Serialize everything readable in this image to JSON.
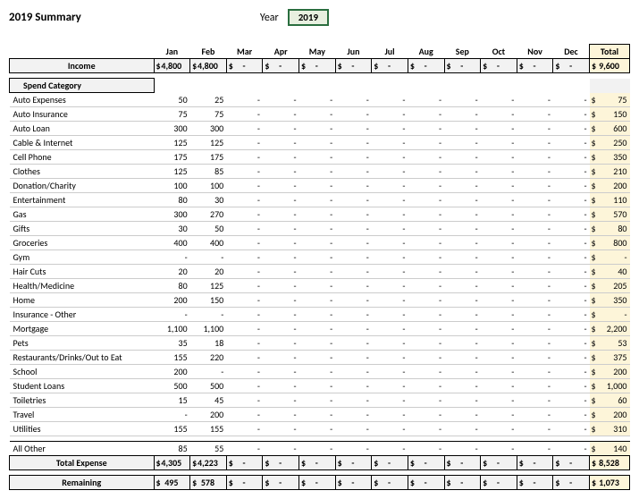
{
  "title": "2019 Summary",
  "year_label": "Year",
  "year_value": "2019",
  "months": [
    "Jan",
    "Feb",
    "Mar",
    "Apr",
    "May",
    "Jun",
    "Jul",
    "Aug",
    "Sep",
    "Oct",
    "Nov",
    "Dec"
  ],
  "total_label": "Total",
  "income_label": "Income",
  "income": {
    "vals": [
      "4,800",
      "4,800",
      "-",
      "-",
      "-",
      "-",
      "-",
      "-",
      "-",
      "-",
      "-",
      "-"
    ],
    "total": "9,600"
  },
  "spend_header": "Spend Category",
  "categories": [
    {
      "name": "Auto Expenses",
      "vals": [
        "50",
        "25",
        "-",
        "-",
        "-",
        "-",
        "-",
        "-",
        "-",
        "-",
        "-",
        "-"
      ],
      "total": "75"
    },
    {
      "name": "Auto Insurance",
      "vals": [
        "75",
        "75",
        "-",
        "-",
        "-",
        "-",
        "-",
        "-",
        "-",
        "-",
        "-",
        "-"
      ],
      "total": "150"
    },
    {
      "name": "Auto Loan",
      "vals": [
        "300",
        "300",
        "-",
        "-",
        "-",
        "-",
        "-",
        "-",
        "-",
        "-",
        "-",
        "-"
      ],
      "total": "600"
    },
    {
      "name": "Cable & Internet",
      "vals": [
        "125",
        "125",
        "-",
        "-",
        "-",
        "-",
        "-",
        "-",
        "-",
        "-",
        "-",
        "-"
      ],
      "total": "250"
    },
    {
      "name": "Cell Phone",
      "vals": [
        "175",
        "175",
        "-",
        "-",
        "-",
        "-",
        "-",
        "-",
        "-",
        "-",
        "-",
        "-"
      ],
      "total": "350"
    },
    {
      "name": "Clothes",
      "vals": [
        "125",
        "85",
        "-",
        "-",
        "-",
        "-",
        "-",
        "-",
        "-",
        "-",
        "-",
        "-"
      ],
      "total": "210"
    },
    {
      "name": "Donation/Charity",
      "vals": [
        "100",
        "100",
        "-",
        "-",
        "-",
        "-",
        "-",
        "-",
        "-",
        "-",
        "-",
        "-"
      ],
      "total": "200"
    },
    {
      "name": "Entertainment",
      "vals": [
        "80",
        "30",
        "-",
        "-",
        "-",
        "-",
        "-",
        "-",
        "-",
        "-",
        "-",
        "-"
      ],
      "total": "110"
    },
    {
      "name": "Gas",
      "vals": [
        "300",
        "270",
        "-",
        "-",
        "-",
        "-",
        "-",
        "-",
        "-",
        "-",
        "-",
        "-"
      ],
      "total": "570"
    },
    {
      "name": "Gifts",
      "vals": [
        "30",
        "50",
        "-",
        "-",
        "-",
        "-",
        "-",
        "-",
        "-",
        "-",
        "-",
        "-"
      ],
      "total": "80"
    },
    {
      "name": "Groceries",
      "vals": [
        "400",
        "400",
        "-",
        "-",
        "-",
        "-",
        "-",
        "-",
        "-",
        "-",
        "-",
        "-"
      ],
      "total": "800"
    },
    {
      "name": "Gym",
      "vals": [
        "-",
        "-",
        "-",
        "-",
        "-",
        "-",
        "-",
        "-",
        "-",
        "-",
        "-",
        "-"
      ],
      "total": "-"
    },
    {
      "name": "Hair Cuts",
      "vals": [
        "20",
        "20",
        "-",
        "-",
        "-",
        "-",
        "-",
        "-",
        "-",
        "-",
        "-",
        "-"
      ],
      "total": "40"
    },
    {
      "name": "Health/Medicine",
      "vals": [
        "80",
        "125",
        "-",
        "-",
        "-",
        "-",
        "-",
        "-",
        "-",
        "-",
        "-",
        "-"
      ],
      "total": "205"
    },
    {
      "name": "Home",
      "vals": [
        "200",
        "150",
        "-",
        "-",
        "-",
        "-",
        "-",
        "-",
        "-",
        "-",
        "-",
        "-"
      ],
      "total": "350"
    },
    {
      "name": "Insurance - Other",
      "vals": [
        "-",
        "-",
        "-",
        "-",
        "-",
        "-",
        "-",
        "-",
        "-",
        "-",
        "-",
        "-"
      ],
      "total": "-"
    },
    {
      "name": "Mortgage",
      "vals": [
        "1,100",
        "1,100",
        "-",
        "-",
        "-",
        "-",
        "-",
        "-",
        "-",
        "-",
        "-",
        "-"
      ],
      "total": "2,200"
    },
    {
      "name": "Pets",
      "vals": [
        "35",
        "18",
        "-",
        "-",
        "-",
        "-",
        "-",
        "-",
        "-",
        "-",
        "-",
        "-"
      ],
      "total": "53"
    },
    {
      "name": "Restaurants/Drinks/Out to Eat",
      "vals": [
        "155",
        "220",
        "-",
        "-",
        "-",
        "-",
        "-",
        "-",
        "-",
        "-",
        "-",
        "-"
      ],
      "total": "375"
    },
    {
      "name": "School",
      "vals": [
        "200",
        "-",
        "-",
        "-",
        "-",
        "-",
        "-",
        "-",
        "-",
        "-",
        "-",
        "-"
      ],
      "total": "200"
    },
    {
      "name": "Student Loans",
      "vals": [
        "500",
        "500",
        "-",
        "-",
        "-",
        "-",
        "-",
        "-",
        "-",
        "-",
        "-",
        "-"
      ],
      "total": "1,000"
    },
    {
      "name": "Toiletries",
      "vals": [
        "15",
        "45",
        "-",
        "-",
        "-",
        "-",
        "-",
        "-",
        "-",
        "-",
        "-",
        "-"
      ],
      "total": "60"
    },
    {
      "name": "Travel",
      "vals": [
        "-",
        "200",
        "-",
        "-",
        "-",
        "-",
        "-",
        "-",
        "-",
        "-",
        "-",
        "-"
      ],
      "total": "200"
    },
    {
      "name": "Utilities",
      "vals": [
        "155",
        "155",
        "-",
        "-",
        "-",
        "-",
        "-",
        "-",
        "-",
        "-",
        "-",
        "-"
      ],
      "total": "310"
    }
  ],
  "all_other_label": "All Other",
  "all_other": {
    "vals": [
      "85",
      "55",
      "-",
      "-",
      "-",
      "-",
      "-",
      "-",
      "-",
      "-",
      "-",
      "-"
    ],
    "total": "140"
  },
  "total_expense_label": "Total Expense",
  "total_expense": {
    "vals": [
      "4,305",
      "4,223",
      "-",
      "-",
      "-",
      "-",
      "-",
      "-",
      "-",
      "-",
      "-",
      "-"
    ],
    "total": "8,528"
  },
  "remaining_label": "Remaining",
  "remaining": {
    "vals": [
      "495",
      "578",
      "-",
      "-",
      "-",
      "-",
      "-",
      "-",
      "-",
      "-",
      "-",
      "-"
    ],
    "total": "1,073"
  }
}
